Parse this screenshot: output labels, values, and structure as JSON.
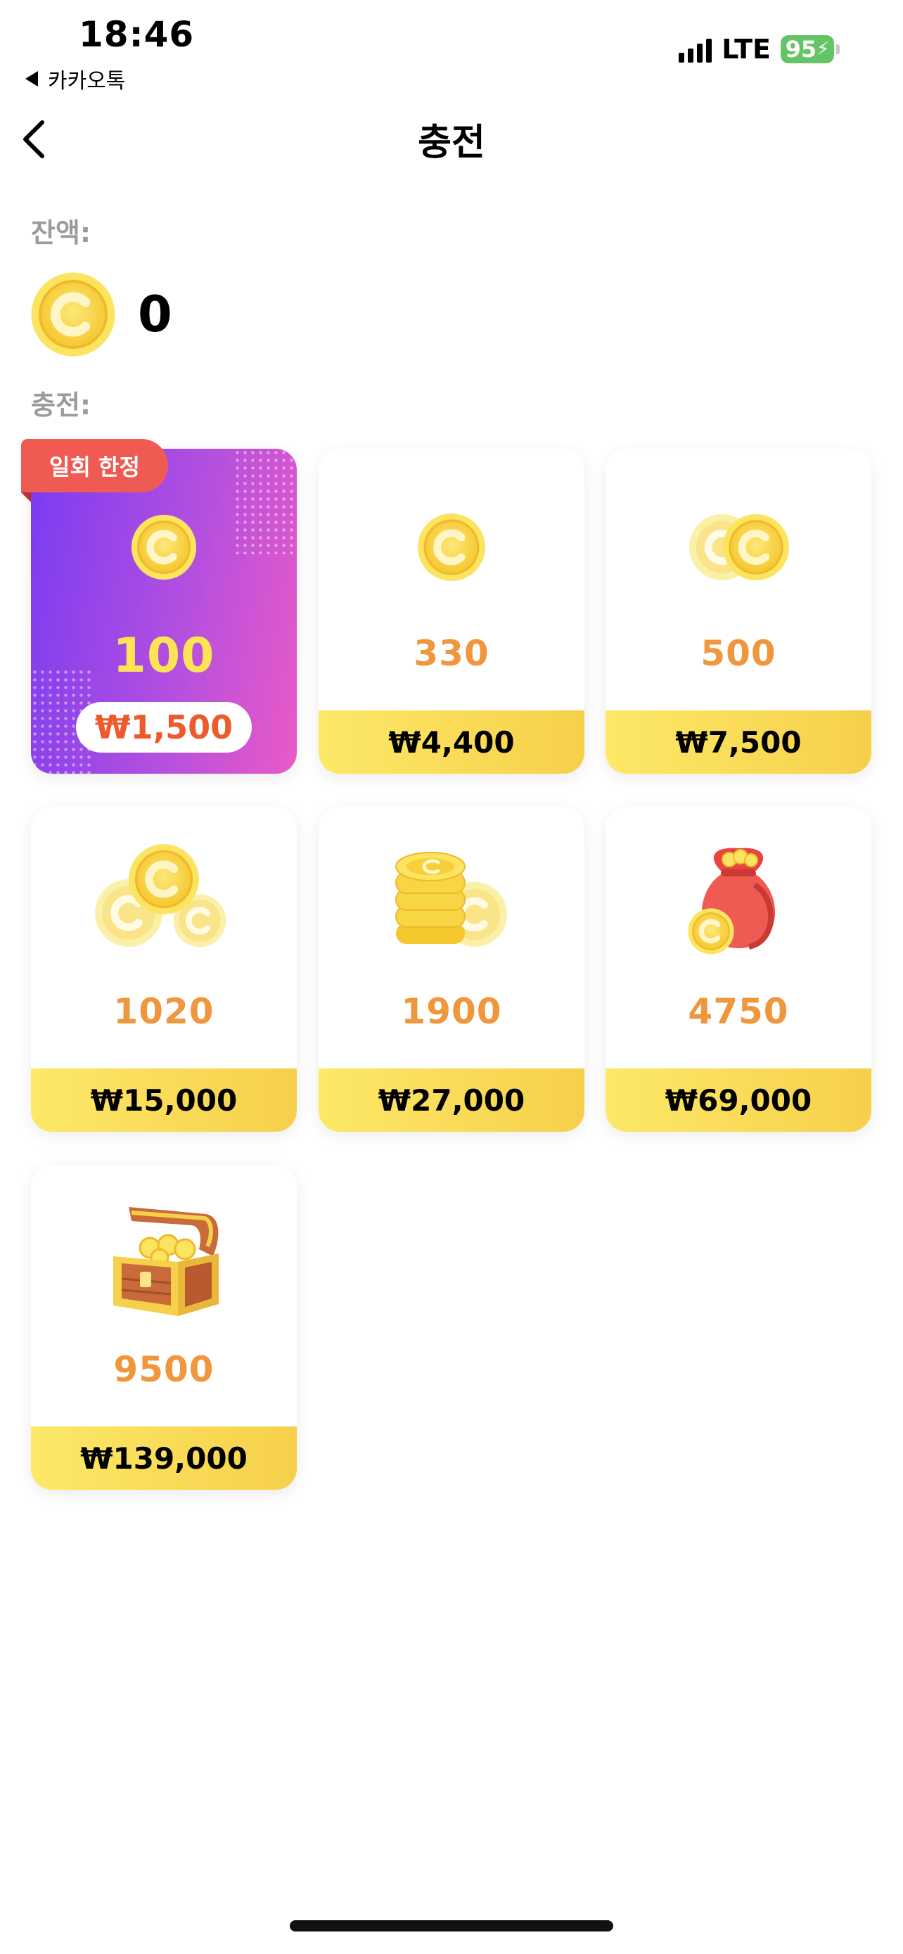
{
  "status_bar": {
    "time": "18:46",
    "back_app": "카카오톡",
    "network": "LTE",
    "battery": "95"
  },
  "nav": {
    "title": "충전"
  },
  "balance": {
    "label": "잔액:",
    "value": "0"
  },
  "charge": {
    "label": "충전:",
    "packages": [
      {
        "amount": "100",
        "price": "₩1,500",
        "badge": "일회 한정",
        "icon": "coin-icon"
      },
      {
        "amount": "330",
        "price": "₩4,400",
        "icon": "coin-icon"
      },
      {
        "amount": "500",
        "price": "₩7,500",
        "icon": "two-coins-icon"
      },
      {
        "amount": "1020",
        "price": "₩15,000",
        "icon": "three-coins-icon"
      },
      {
        "amount": "1900",
        "price": "₩27,000",
        "icon": "coin-stack-icon"
      },
      {
        "amount": "4750",
        "price": "₩69,000",
        "icon": "coin-bag-icon"
      },
      {
        "amount": "9500",
        "price": "₩139,000",
        "icon": "treasure-chest-icon"
      }
    ]
  },
  "colors": {
    "amount_orange": "#f0963c",
    "price_bar": "#f6d04a",
    "promo_gradient_start": "#7a3bf2",
    "promo_gradient_end": "#ea5ac6",
    "badge_red": "#ef5a52"
  }
}
